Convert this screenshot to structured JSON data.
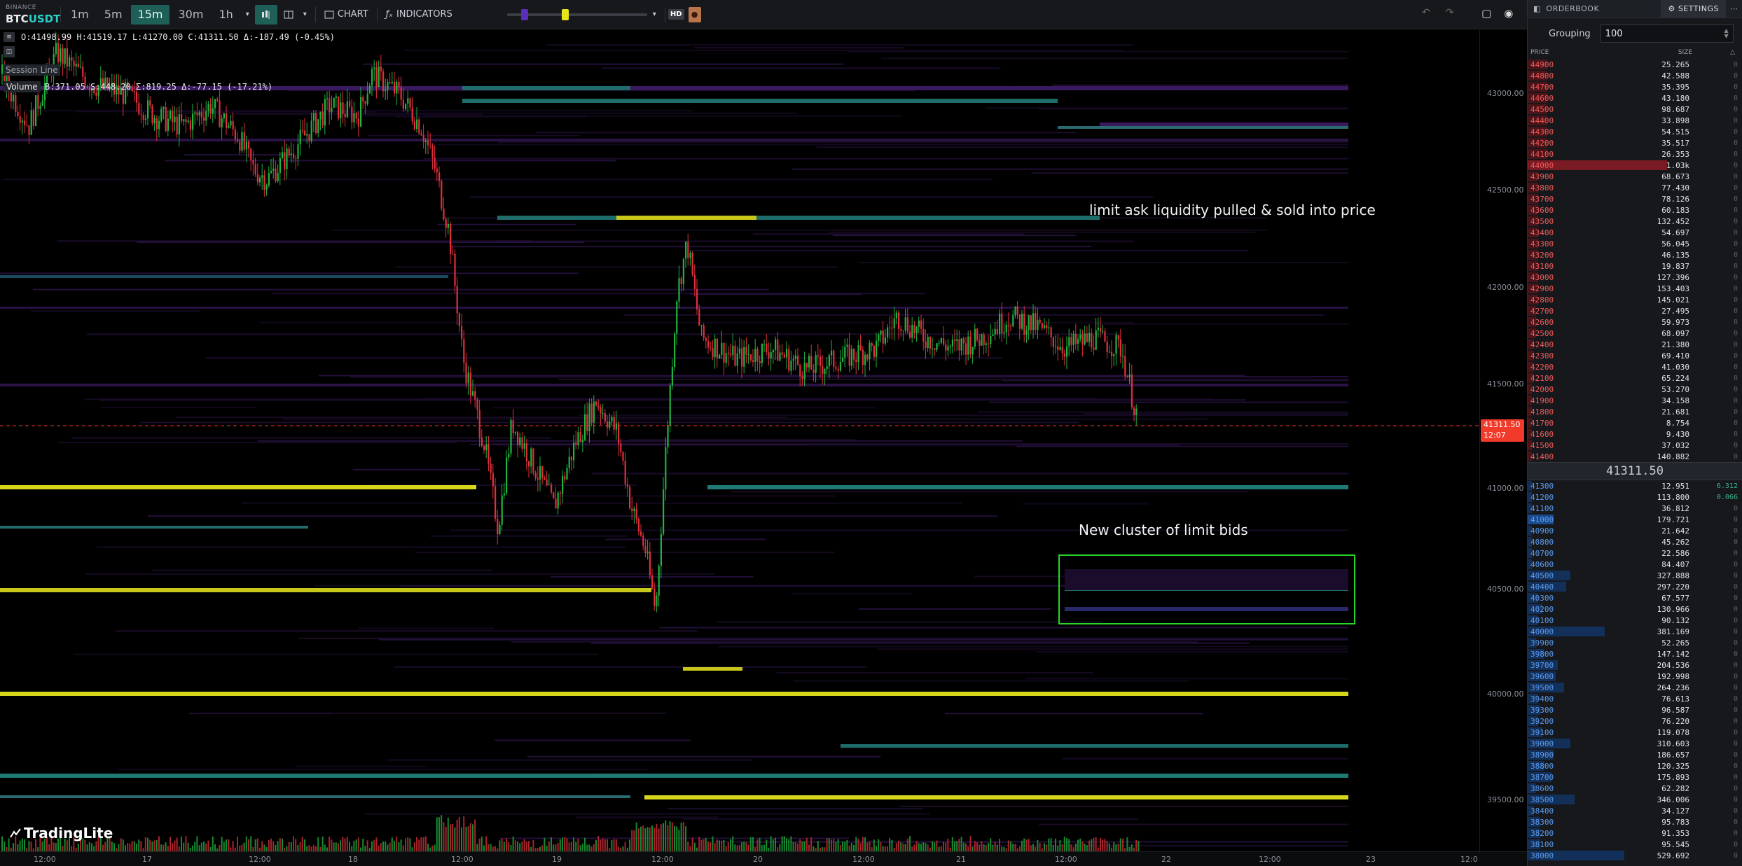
{
  "toolbar": {
    "exchange": "BINANCE",
    "pair_base": "BTC",
    "pair_quote": "USDT",
    "timeframes": [
      {
        "label": "1m",
        "active": false
      },
      {
        "label": "5m",
        "active": false
      },
      {
        "label": "15m",
        "active": true
      },
      {
        "label": "30m",
        "active": false
      },
      {
        "label": "1h",
        "active": false
      }
    ],
    "chart_label": "CHART",
    "indicators_label": "INDICATORS",
    "hd_label": "HD"
  },
  "legend": {
    "ohlc": "O:41498.99 H:41519.17 L:41270.00 C:41311.50 Δ:-187.49 (-0.45%)",
    "session_line": "Session Line",
    "volume_label": "Volume",
    "volume_values": "B:371.05 S:448.20 Σ:819.25 Δ:-77.15 (-17.21%)"
  },
  "annotations": {
    "ask_note": "limit ask liquidity pulled & sold into price",
    "bid_note": "New cluster of limit bids"
  },
  "logo_text": "TradingLite",
  "price_axis": {
    "labels": [
      "43000.00",
      "42500.00",
      "42000.00",
      "41500.00",
      "41000.00",
      "40500.00",
      "40000.00",
      "39500.00"
    ],
    "current_price": "41311.50",
    "countdown": "12:07"
  },
  "time_axis": {
    "labels": [
      "12:00",
      "17",
      "12:00",
      "18",
      "12:00",
      "19",
      "12:00",
      "20",
      "12:00",
      "21",
      "12:00",
      "22",
      "12:00",
      "23",
      "12:0"
    ]
  },
  "orderbook": {
    "title": "ORDERBOOK",
    "settings_label": "SETTINGS",
    "grouping_label": "Grouping",
    "grouping_value": "100",
    "col_price": "PRICE",
    "col_size": "SIZE",
    "mid_price": "41311.50",
    "asks": [
      {
        "price": "44900",
        "size": "25.265",
        "depth": 0.09
      },
      {
        "price": "44800",
        "size": "42.588",
        "depth": 0.09
      },
      {
        "price": "44700",
        "size": "35.395",
        "depth": 0.09
      },
      {
        "price": "44600",
        "size": "43.180",
        "depth": 0.09
      },
      {
        "price": "44500",
        "size": "98.687",
        "depth": 0.09
      },
      {
        "price": "44400",
        "size": "33.898",
        "depth": 0.09
      },
      {
        "price": "44300",
        "size": "54.515",
        "depth": 0.09
      },
      {
        "price": "44200",
        "size": "35.517",
        "depth": 0.09
      },
      {
        "price": "44100",
        "size": "26.353",
        "depth": 0.09
      },
      {
        "price": "44000",
        "size": "1.03k",
        "depth": 0.65,
        "hl": true
      },
      {
        "price": "43900",
        "size": "68.673",
        "depth": 0.05
      },
      {
        "price": "43800",
        "size": "77.430",
        "depth": 0.05
      },
      {
        "price": "43700",
        "size": "78.126",
        "depth": 0.05
      },
      {
        "price": "43600",
        "size": "60.183",
        "depth": 0.05
      },
      {
        "price": "43500",
        "size": "132.452",
        "depth": 0.05
      },
      {
        "price": "43400",
        "size": "54.697",
        "depth": 0.05
      },
      {
        "price": "43300",
        "size": "56.045",
        "depth": 0.05
      },
      {
        "price": "43200",
        "size": "46.135",
        "depth": 0.05
      },
      {
        "price": "43100",
        "size": "19.837",
        "depth": 0.05
      },
      {
        "price": "43000",
        "size": "127.396",
        "depth": 0.05
      },
      {
        "price": "42900",
        "size": "153.403",
        "depth": 0.05
      },
      {
        "price": "42800",
        "size": "145.021",
        "depth": 0.05
      },
      {
        "price": "42700",
        "size": "27.495",
        "depth": 0.04
      },
      {
        "price": "42600",
        "size": "59.973",
        "depth": 0.04
      },
      {
        "price": "42500",
        "size": "68.097",
        "depth": 0.04
      },
      {
        "price": "42400",
        "size": "21.380",
        "depth": 0.03
      },
      {
        "price": "42300",
        "size": "69.410",
        "depth": 0.03
      },
      {
        "price": "42200",
        "size": "41.030",
        "depth": 0.03
      },
      {
        "price": "42100",
        "size": "65.224",
        "depth": 0.03
      },
      {
        "price": "42000",
        "size": "53.270",
        "depth": 0.02
      },
      {
        "price": "41900",
        "size": "34.158",
        "depth": 0.02
      },
      {
        "price": "41800",
        "size": "21.681",
        "depth": 0.02
      },
      {
        "price": "41700",
        "size": "8.754",
        "depth": 0.01
      },
      {
        "price": "41600",
        "size": "9.430",
        "depth": 0.01
      },
      {
        "price": "41500",
        "size": "37.032",
        "depth": 0.01
      },
      {
        "price": "41400",
        "size": "140.882",
        "depth": 0.01
      }
    ],
    "bids": [
      {
        "price": "41300",
        "size": "12.951",
        "depth": 0.0,
        "extra": "6.312"
      },
      {
        "price": "41200",
        "size": "113.800",
        "depth": 0.0,
        "extra": "0.066"
      },
      {
        "price": "41100",
        "size": "36.812",
        "depth": 0.0
      },
      {
        "price": "41000",
        "size": "179.721",
        "depth": 0.12,
        "hl": true
      },
      {
        "price": "40900",
        "size": "21.642",
        "depth": 0.0
      },
      {
        "price": "40800",
        "size": "45.262",
        "depth": 0.0
      },
      {
        "price": "40700",
        "size": "22.586",
        "depth": 0.0
      },
      {
        "price": "40600",
        "size": "84.407",
        "depth": 0.0
      },
      {
        "price": "40500",
        "size": "327.888",
        "depth": 0.2
      },
      {
        "price": "40400",
        "size": "297.220",
        "depth": 0.18
      },
      {
        "price": "40300",
        "size": "67.577",
        "depth": 0.05
      },
      {
        "price": "40200",
        "size": "130.966",
        "depth": 0.07
      },
      {
        "price": "40100",
        "size": "90.132",
        "depth": 0.05
      },
      {
        "price": "40000",
        "size": "381.169",
        "depth": 0.36
      },
      {
        "price": "39900",
        "size": "52.265",
        "depth": 0.04
      },
      {
        "price": "39800",
        "size": "147.142",
        "depth": 0.08
      },
      {
        "price": "39700",
        "size": "204.536",
        "depth": 0.14
      },
      {
        "price": "39600",
        "size": "192.998",
        "depth": 0.13
      },
      {
        "price": "39500",
        "size": "264.236",
        "depth": 0.17
      },
      {
        "price": "39400",
        "size": "76.613",
        "depth": 0.05
      },
      {
        "price": "39300",
        "size": "96.587",
        "depth": 0.06
      },
      {
        "price": "39200",
        "size": "76.220",
        "depth": 0.05
      },
      {
        "price": "39100",
        "size": "119.078",
        "depth": 0.07
      },
      {
        "price": "39000",
        "size": "310.603",
        "depth": 0.2
      },
      {
        "price": "38900",
        "size": "186.657",
        "depth": 0.12
      },
      {
        "price": "38800",
        "size": "120.325",
        "depth": 0.08
      },
      {
        "price": "38700",
        "size": "175.893",
        "depth": 0.11
      },
      {
        "price": "38600",
        "size": "62.282",
        "depth": 0.04
      },
      {
        "price": "38500",
        "size": "346.006",
        "depth": 0.22
      },
      {
        "price": "38400",
        "size": "34.127",
        "depth": 0.03
      },
      {
        "price": "38300",
        "size": "95.783",
        "depth": 0.06
      },
      {
        "price": "38200",
        "size": "91.353",
        "depth": 0.06
      },
      {
        "price": "38100",
        "size": "95.545",
        "depth": 0.06
      },
      {
        "price": "38000",
        "size": "529.692",
        "depth": 0.45
      }
    ]
  },
  "colors": {
    "up_candle": "#1fb33f",
    "down_candle": "#e0303a",
    "heat_low": "#2a1040",
    "heat_mid": "#1e7a72",
    "heat_high": "#d6d61a",
    "annotation_box": "#28d628",
    "price_line": "#f23a2a"
  }
}
